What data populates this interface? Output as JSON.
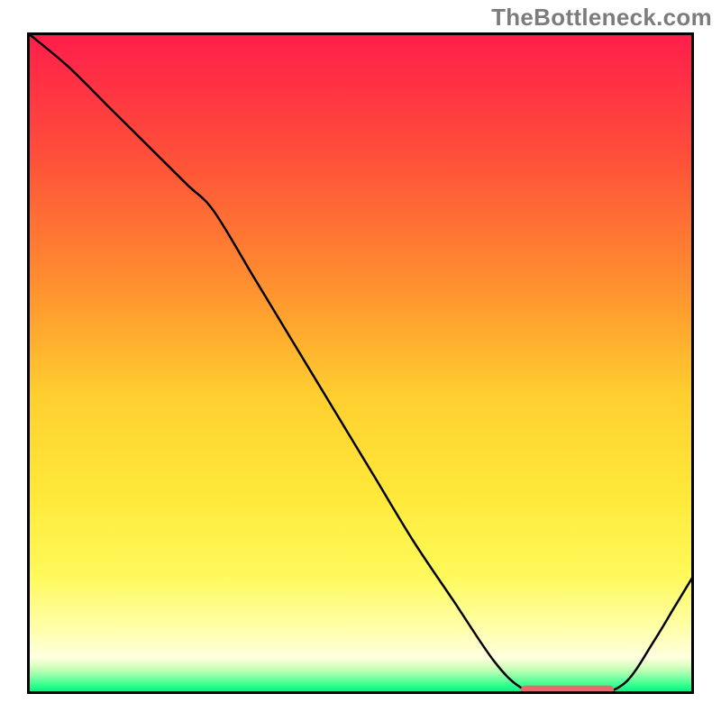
{
  "watermark": "TheBottleneck.com",
  "chart_data": {
    "type": "line",
    "title": "",
    "xlabel": "",
    "ylabel": "",
    "xlim": [
      0,
      100
    ],
    "ylim": [
      0,
      100
    ],
    "axes_visible": false,
    "background": {
      "type": "vertical_gradient",
      "stops": [
        {
          "pos": 0.0,
          "color": "#ff1d4b"
        },
        {
          "pos": 0.18,
          "color": "#ff4d3a"
        },
        {
          "pos": 0.38,
          "color": "#ff8f2f"
        },
        {
          "pos": 0.55,
          "color": "#ffcf2f"
        },
        {
          "pos": 0.7,
          "color": "#ffe93a"
        },
        {
          "pos": 0.82,
          "color": "#fff95a"
        },
        {
          "pos": 0.9,
          "color": "#ffffa8"
        },
        {
          "pos": 0.945,
          "color": "#ffffe0"
        },
        {
          "pos": 0.958,
          "color": "#d9ffc0"
        },
        {
          "pos": 0.968,
          "color": "#a8ffb0"
        },
        {
          "pos": 0.978,
          "color": "#6cffa0"
        },
        {
          "pos": 0.988,
          "color": "#2eff8c"
        },
        {
          "pos": 1.0,
          "color": "#00e57a"
        }
      ]
    },
    "series": [
      {
        "name": "curve",
        "x": [
          0,
          6,
          12,
          18,
          24,
          28,
          34,
          40,
          46,
          52,
          58,
          64,
          70,
          74,
          78,
          82,
          86,
          90,
          94,
          97,
          100
        ],
        "y": [
          100,
          95,
          89,
          83,
          77,
          73,
          63,
          53,
          43,
          33,
          23,
          14,
          5,
          1,
          0,
          0,
          0,
          2,
          8,
          13,
          18
        ],
        "color": "#000000",
        "width": 2.5
      }
    ],
    "markers": [
      {
        "name": "flat-segment-marker",
        "shape": "rounded_bar",
        "x_start": 74,
        "x_end": 88,
        "y": 0.6,
        "color": "#e76b6b"
      }
    ]
  }
}
